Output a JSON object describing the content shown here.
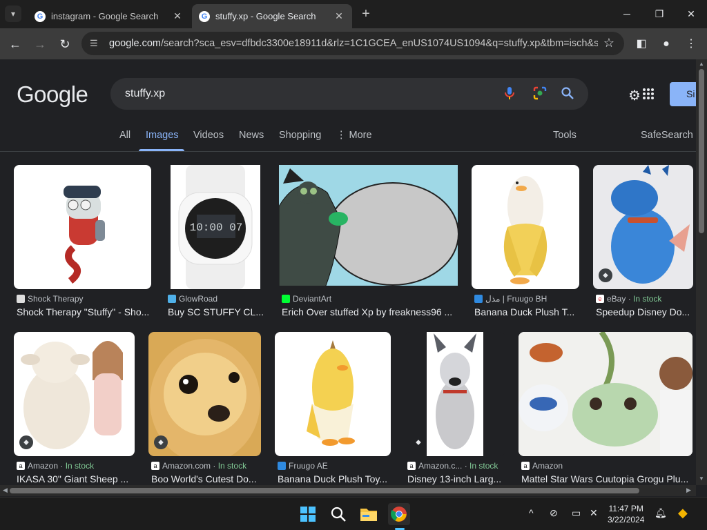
{
  "browser": {
    "tabs": [
      {
        "title": "instagram - Google Search",
        "favicon": "google-g-icon",
        "active": false
      },
      {
        "title": "stuffy.xp - Google Search",
        "favicon": "google-g-icon",
        "active": true
      }
    ],
    "url_host": "google.com",
    "url_rest": "/search?sca_esv=dfbdc3300e18911d&rlz=1C1GCEA_enUS1074US1094&q=stuffy.xp&tbm=isch&sour..."
  },
  "google": {
    "logo": "Google",
    "query": "stuffy.xp",
    "signin_label": "Si",
    "tabs": [
      "All",
      "Images",
      "Videos",
      "News",
      "Shopping",
      "More"
    ],
    "tools_label": "Tools",
    "safesearch_label": "SafeSearch",
    "accent": "#8ab4f8"
  },
  "results": [
    {
      "source": "Shock Therapy",
      "stock": "",
      "caption": "Shock Therapy \"Stuffy\" - Sho...",
      "tag": false
    },
    {
      "source": "GlowRoad",
      "stock": "",
      "caption": "Buy SC STUFFY CL...",
      "tag": false
    },
    {
      "source": "DeviantArt",
      "stock": "",
      "caption": "Erich Over stuffed Xp by freakness96 ...",
      "tag": false
    },
    {
      "source": "مذل | Fruugo BH",
      "stock": "",
      "caption": "Banana Duck Plush T...",
      "tag": false
    },
    {
      "source": "eBay",
      "stock": "In stock",
      "caption": "Speedup Disney Do...",
      "tag": true
    },
    {
      "source": "Amazon",
      "stock": "In stock",
      "caption": "IKASA 30\" Giant Sheep ...",
      "tag": true
    },
    {
      "source": "Amazon.com",
      "stock": "In stock",
      "caption": "Boo World's Cutest Do...",
      "tag": true
    },
    {
      "source": "Fruugo AE",
      "stock": "",
      "caption": "Banana Duck Plush Toy...",
      "tag": false
    },
    {
      "source": "Amazon.c...",
      "stock": "In stock",
      "caption": "Disney 13-inch Larg...",
      "tag": true
    },
    {
      "source": "Amazon",
      "stock": "",
      "caption": "Mattel Star Wars Cuutopia Grogu Plu...",
      "tag": false
    }
  ],
  "stock_separator": "·",
  "taskbar": {
    "time": "11:47 PM",
    "date": "3/22/2024"
  }
}
